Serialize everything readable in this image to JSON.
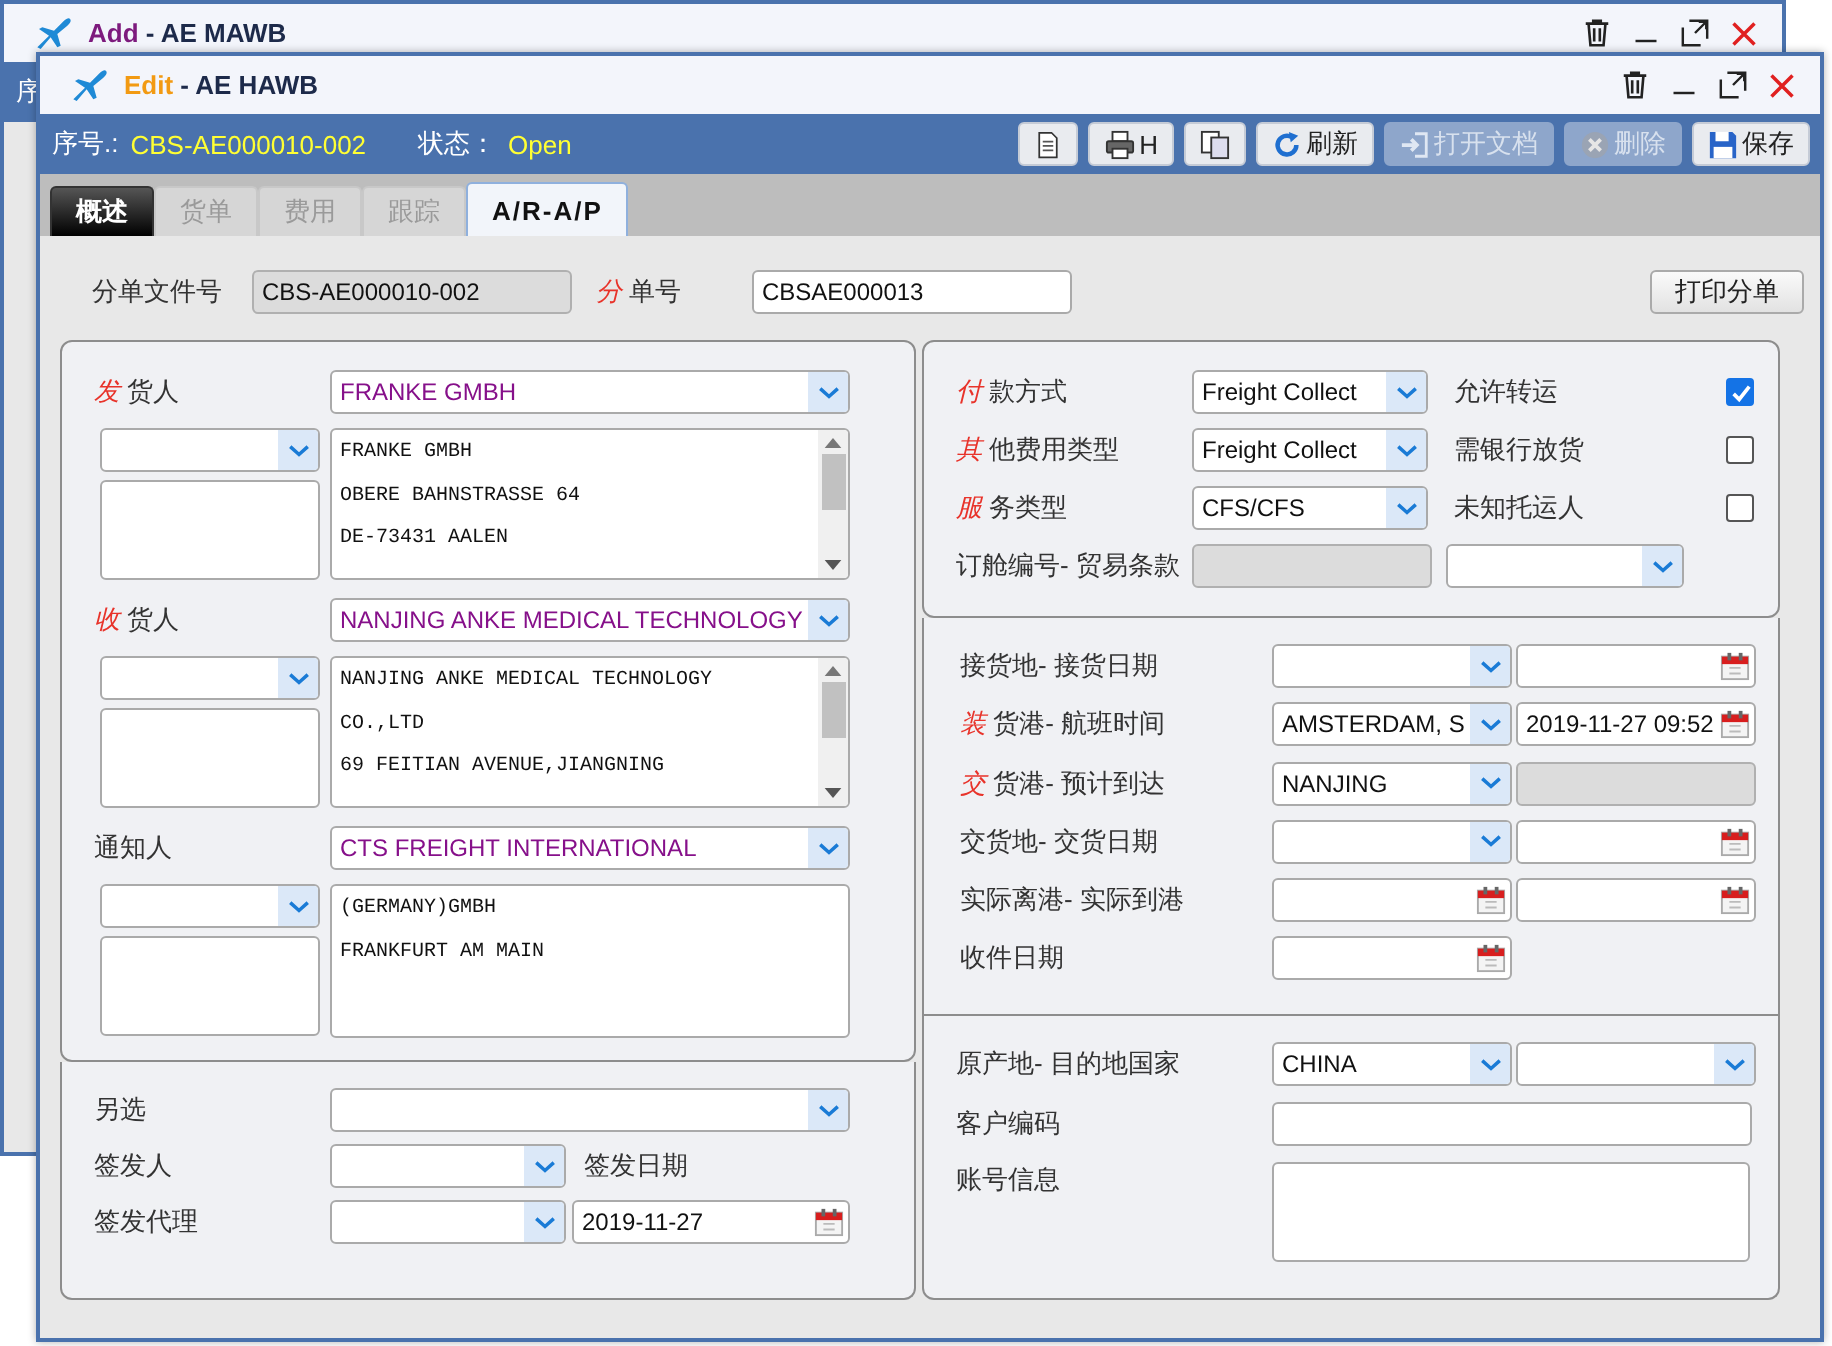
{
  "background_window": {
    "action": "Add",
    "separator": "-",
    "title": "AE MAWB",
    "info_label": "序"
  },
  "window": {
    "action": "Edit",
    "separator": "-",
    "title": "AE HAWB"
  },
  "info_bar": {
    "serial_label": "序号.:",
    "serial": "CBS-AE000010-002",
    "status_label": "状态：",
    "status": "Open"
  },
  "toolbar": [
    {
      "kind": "document",
      "disabled": false
    },
    {
      "kind": "print",
      "label": "H",
      "disabled": false
    },
    {
      "kind": "copy",
      "disabled": false
    },
    {
      "kind": "refresh",
      "label": "刷新",
      "disabled": false
    },
    {
      "kind": "open",
      "label": "打开文档",
      "disabled": true
    },
    {
      "kind": "delete",
      "label": "删除",
      "disabled": true
    },
    {
      "kind": "save",
      "label": "保存",
      "disabled": false
    }
  ],
  "tabs": [
    {
      "label": "概述",
      "selected": false,
      "hovered": true
    },
    {
      "label": "货单",
      "selected": false,
      "hovered": false
    },
    {
      "label": "费用",
      "selected": false,
      "hovered": false
    },
    {
      "label": "跟踪",
      "selected": false,
      "hovered": false
    },
    {
      "label": "A/R-A/P",
      "selected": true,
      "hovered": false
    }
  ],
  "header": {
    "file_no_label": "分单文件号",
    "file_no": "CBS-AE000010-002",
    "hawb_label": {
      "mark": "分",
      "text": "单号"
    },
    "hawb": "CBSAE000013",
    "print_button": "打印分单"
  },
  "parties": [
    {
      "label": {
        "mark": "发",
        "text": "货人"
      },
      "name": "FRANKE GMBH",
      "address_lines": [
        "FRANKE GMBH",
        "OBERE BAHNSTRASSE 64",
        "DE-73431 AALEN"
      ],
      "scrollable": true
    },
    {
      "label": {
        "mark": "收",
        "text": "货人"
      },
      "name": "NANJING ANKE MEDICAL TECHNOLOGY",
      "address_lines": [
        "NANJING ANKE MEDICAL TECHNOLOGY",
        "CO.,LTD",
        "69 FEITIAN AVENUE,JIANGNING"
      ],
      "scrollable": true
    },
    {
      "label": {
        "text": "通知人"
      },
      "name": "CTS FREIGHT INTERNATIONAL",
      "address_lines": [
        "(GERMANY)GMBH",
        "FRANKFURT AM MAIN"
      ],
      "scrollable": false
    }
  ],
  "issue": {
    "alternate_label": "另选",
    "issuer_label": "签发人",
    "issue_date_label": "签发日期",
    "agent_label": "签发代理",
    "issue_date": "2019-11-27"
  },
  "terms": [
    {
      "label": {
        "mark": "付",
        "text": "款方式"
      },
      "value": "Freight Collect",
      "option_label": "允许转运",
      "checked": true
    },
    {
      "label": {
        "mark": "其",
        "text": "他费用类型"
      },
      "value": "Freight Collect",
      "option_label": "需银行放货",
      "checked": false
    },
    {
      "label": {
        "mark": "服",
        "text": "务类型"
      },
      "value": "CFS/CFS",
      "option_label": "未知托运人",
      "checked": false
    }
  ],
  "booking": {
    "label": "订舱编号- 贸易条款"
  },
  "schedule": [
    {
      "label": {
        "text": "接货地- 接货日期"
      },
      "fields": [
        {
          "kind": "select"
        },
        {
          "kind": "date"
        }
      ]
    },
    {
      "label": {
        "mark": "装",
        "text": "货港- 航班时间"
      },
      "fields": [
        {
          "kind": "select",
          "value": "AMSTERDAM, S"
        },
        {
          "kind": "date",
          "value": "2019-11-27 09:52"
        }
      ]
    },
    {
      "label": {
        "mark": "交",
        "text": "货港- 预计到达"
      },
      "fields": [
        {
          "kind": "select",
          "value": "NANJING"
        },
        {
          "kind": "disabled"
        }
      ]
    },
    {
      "label": {
        "text": "交货地- 交货日期"
      },
      "fields": [
        {
          "kind": "select"
        },
        {
          "kind": "date"
        }
      ]
    },
    {
      "label": {
        "text": "实际离港- 实际到港"
      },
      "fields": [
        {
          "kind": "date"
        },
        {
          "kind": "date"
        }
      ]
    },
    {
      "label": {
        "text": "收件日期"
      },
      "fields": [
        {
          "kind": "date"
        }
      ]
    }
  ],
  "country": {
    "label": "原产地- 目的地国家",
    "origin": "CHINA",
    "customer_code_label": "客户编码",
    "account_label": "账号信息"
  }
}
